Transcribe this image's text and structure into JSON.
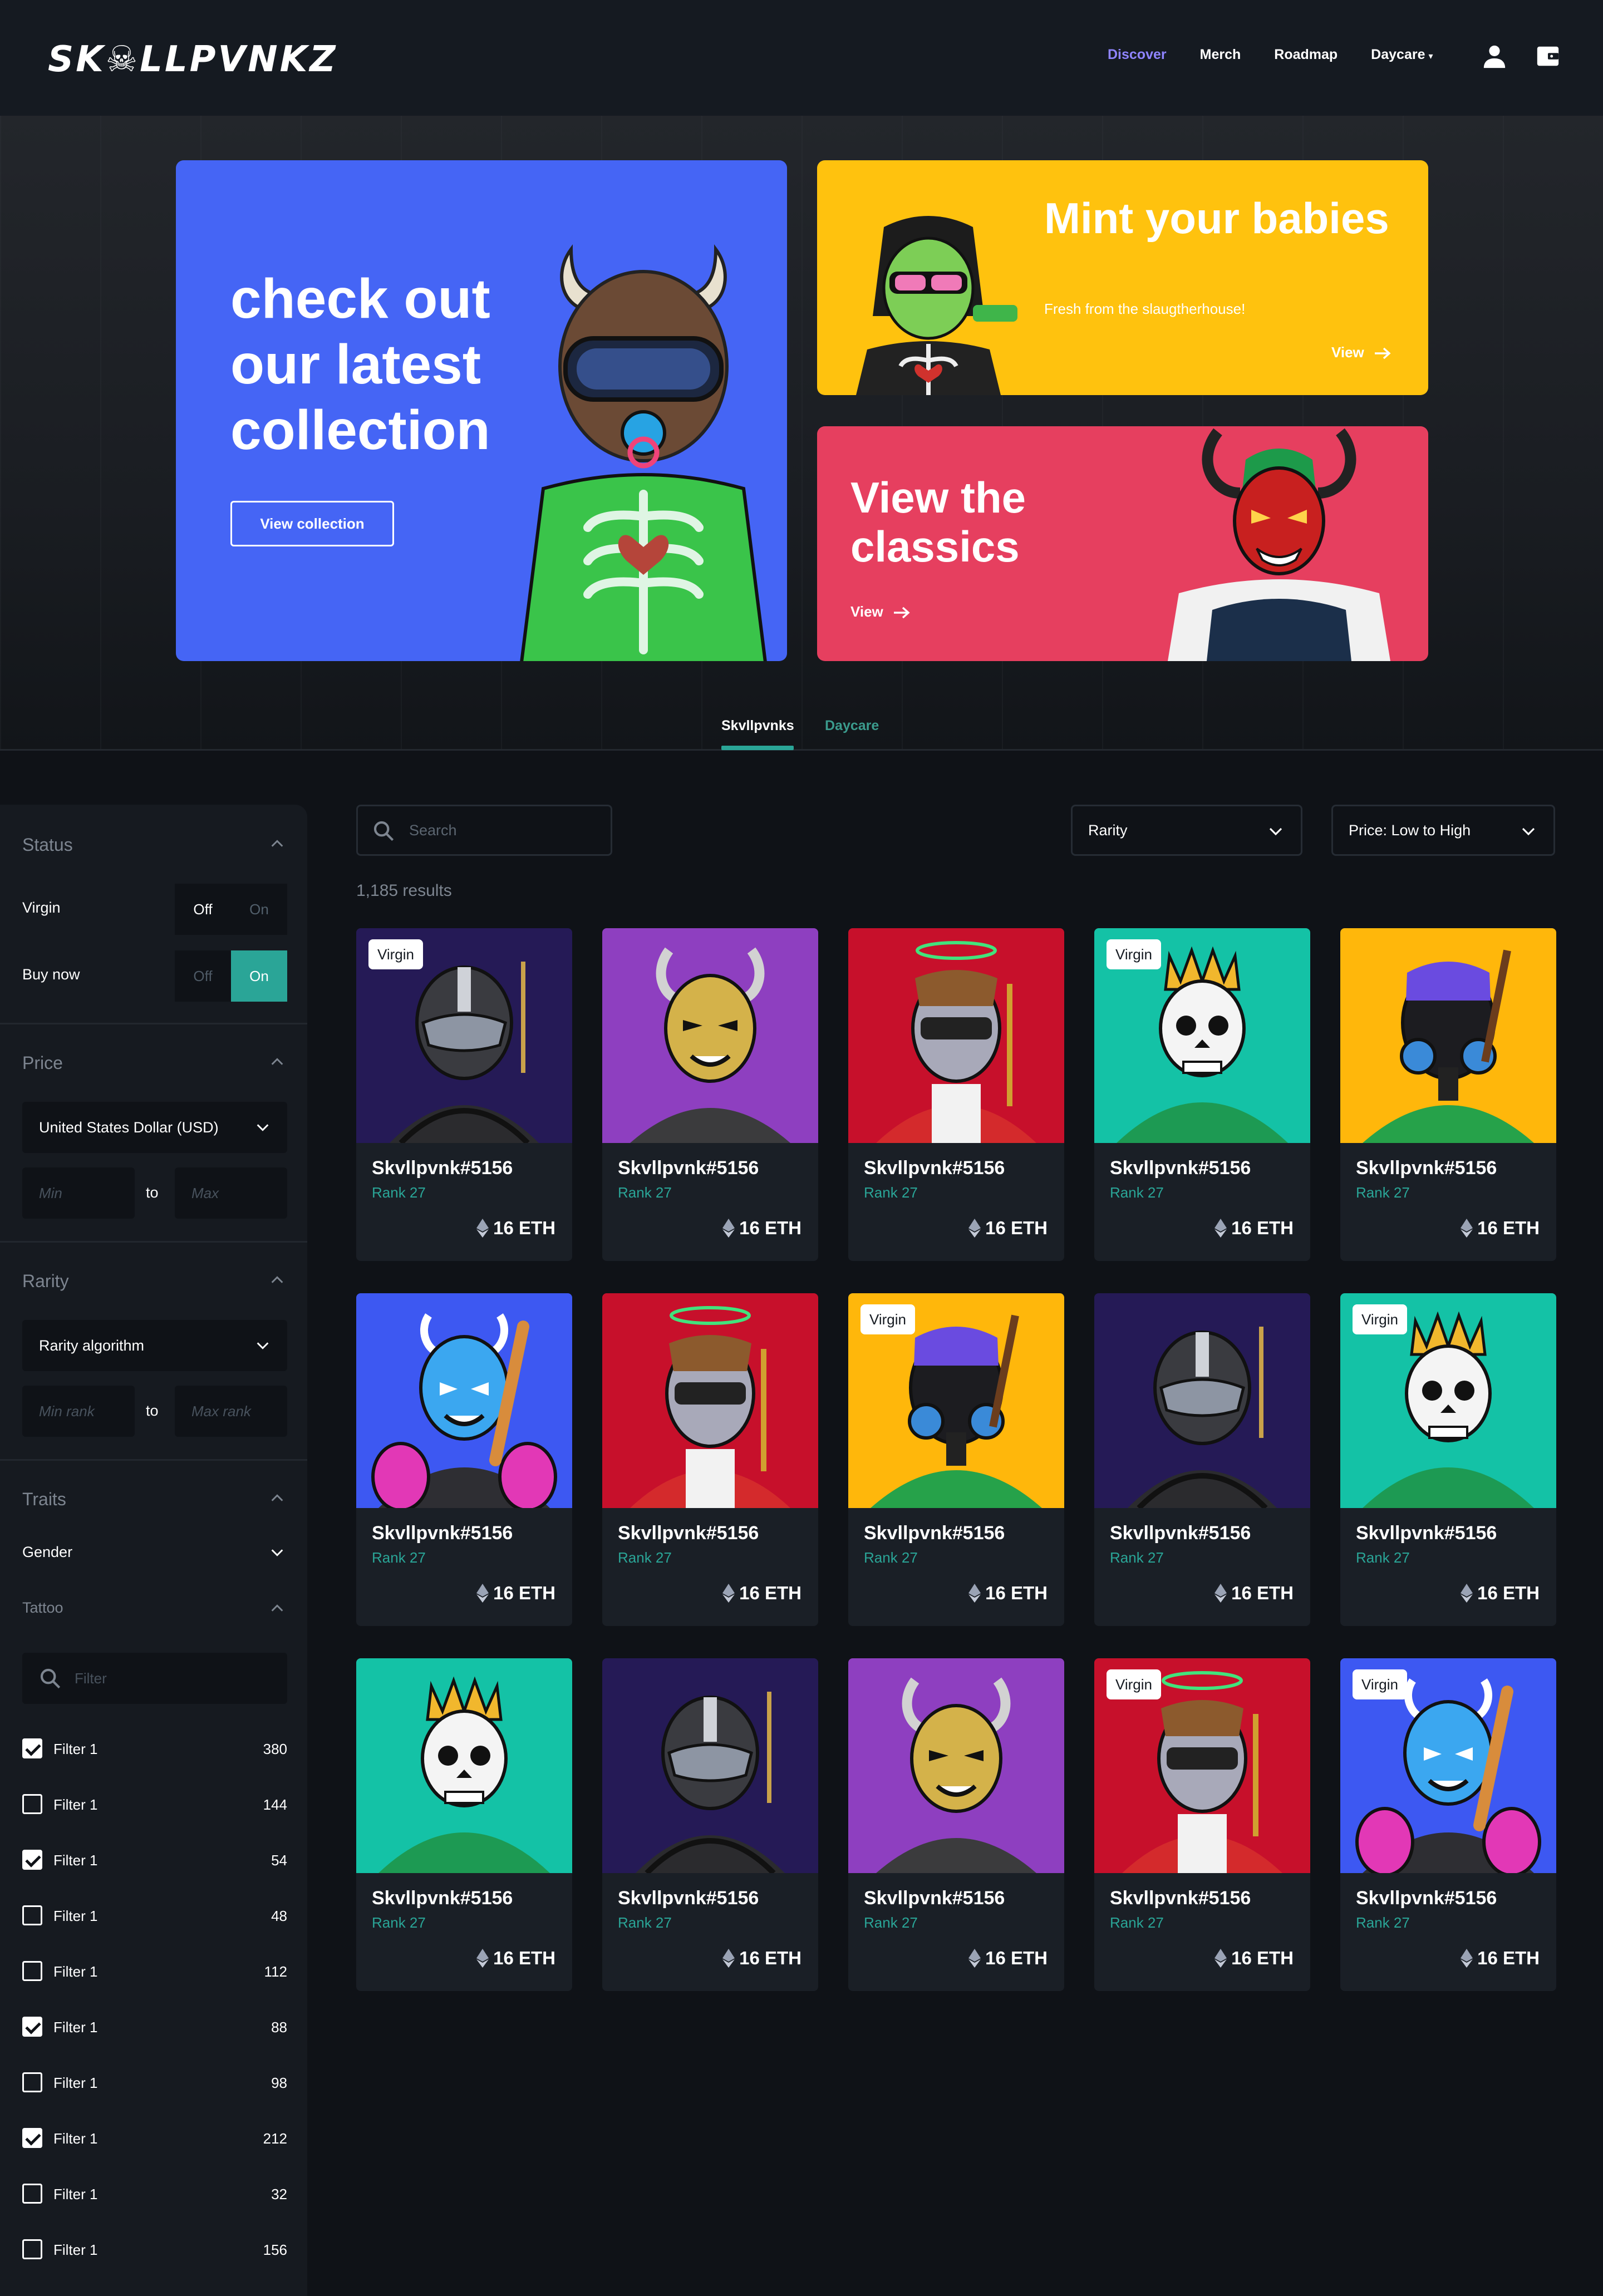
{
  "header": {
    "logo": "SK☠LLPVNKZ",
    "nav": [
      {
        "label": "Discover",
        "active": true
      },
      {
        "label": "Merch",
        "active": false
      },
      {
        "label": "Roadmap",
        "active": false
      },
      {
        "label": "Daycare",
        "active": false,
        "has_caret": true
      }
    ],
    "icons": [
      "user-icon",
      "wallet-icon"
    ]
  },
  "hero": {
    "main": {
      "title": "check out our latest collection",
      "button": "View collection",
      "color": "#4565f5"
    },
    "mint": {
      "title": "Mint your babies",
      "subtitle": "Fresh from the slaugtherhouse!",
      "link": "View",
      "color": "#ffc20e"
    },
    "classics": {
      "title": "View the classics",
      "link": "View",
      "color": "#e63f5f"
    }
  },
  "tabs": [
    {
      "label": "Skvllpvnks",
      "active": true
    },
    {
      "label": "Daycare",
      "active": false
    }
  ],
  "sidebar": {
    "status": {
      "title": "Status",
      "rows": [
        {
          "label": "Virgin",
          "off": "Off",
          "on": "On",
          "value": "off"
        },
        {
          "label": "Buy now",
          "off": "Off",
          "on": "On",
          "value": "on"
        }
      ]
    },
    "price": {
      "title": "Price",
      "currency": "United States Dollar (USD)",
      "min_placeholder": "Min",
      "to": "to",
      "max_placeholder": "Max"
    },
    "rarity": {
      "title": "Rarity",
      "algorithm": "Rarity algorithm",
      "min_placeholder": "Min rank",
      "to": "to",
      "max_placeholder": "Max rank"
    },
    "traits": {
      "title": "Traits",
      "gender": "Gender",
      "tattoo": "Tattoo",
      "filter_placeholder": "Filter",
      "filters": [
        {
          "label": "Filter 1",
          "count": "380",
          "checked": true
        },
        {
          "label": "Filter 1",
          "count": "144",
          "checked": false
        },
        {
          "label": "Filter 1",
          "count": "54",
          "checked": true
        },
        {
          "label": "Filter 1",
          "count": "48",
          "checked": false
        },
        {
          "label": "Filter 1",
          "count": "112",
          "checked": false
        },
        {
          "label": "Filter 1",
          "count": "88",
          "checked": true
        },
        {
          "label": "Filter 1",
          "count": "98",
          "checked": false
        },
        {
          "label": "Filter 1",
          "count": "212",
          "checked": true
        },
        {
          "label": "Filter 1",
          "count": "32",
          "checked": false
        },
        {
          "label": "Filter 1",
          "count": "156",
          "checked": false
        }
      ]
    }
  },
  "main": {
    "search_placeholder": "Search",
    "rarity_select": "Rarity",
    "sort_select": "Price: Low to High",
    "results": "1,185 results",
    "badge_label": "Virgin",
    "cards": [
      {
        "name": "Skvllpvnk#5156",
        "rank": "Rank 27",
        "price": "16 ETH",
        "bg": "#251a56",
        "char": "helmet",
        "virgin": true
      },
      {
        "name": "Skvllpvnk#5156",
        "rank": "Rank 27",
        "price": "16 ETH",
        "bg": "#8e3fc0",
        "char": "oni-gold",
        "virgin": false
      },
      {
        "name": "Skvllpvnk#5156",
        "rank": "Rank 27",
        "price": "16 ETH",
        "bg": "#c7102b",
        "char": "halo",
        "virgin": false
      },
      {
        "name": "Skvllpvnk#5156",
        "rank": "Rank 27",
        "price": "16 ETH",
        "bg": "#14c2a6",
        "char": "skull-king",
        "virgin": true
      },
      {
        "name": "Skvllpvnk#5156",
        "rank": "Rank 27",
        "price": "16 ETH",
        "bg": "#ffb70b",
        "char": "gasmask",
        "virgin": false
      },
      {
        "name": "Skvllpvnk#5156",
        "rank": "Rank 27",
        "price": "16 ETH",
        "bg": "#3d58f2",
        "char": "oni-blue",
        "virgin": false
      },
      {
        "name": "Skvllpvnk#5156",
        "rank": "Rank 27",
        "price": "16 ETH",
        "bg": "#c7102b",
        "char": "halo",
        "virgin": false
      },
      {
        "name": "Skvllpvnk#5156",
        "rank": "Rank 27",
        "price": "16 ETH",
        "bg": "#ffb70b",
        "char": "gasmask",
        "virgin": true
      },
      {
        "name": "Skvllpvnk#5156",
        "rank": "Rank 27",
        "price": "16 ETH",
        "bg": "#251a56",
        "char": "helmet",
        "virgin": false
      },
      {
        "name": "Skvllpvnk#5156",
        "rank": "Rank 27",
        "price": "16 ETH",
        "bg": "#14c2a6",
        "char": "skull-king",
        "virgin": true
      },
      {
        "name": "Skvllpvnk#5156",
        "rank": "Rank 27",
        "price": "16 ETH",
        "bg": "#14c2a6",
        "char": "skull-king",
        "virgin": false
      },
      {
        "name": "Skvllpvnk#5156",
        "rank": "Rank 27",
        "price": "16 ETH",
        "bg": "#251a56",
        "char": "helmet",
        "virgin": false
      },
      {
        "name": "Skvllpvnk#5156",
        "rank": "Rank 27",
        "price": "16 ETH",
        "bg": "#8e3fc0",
        "char": "oni-gold",
        "virgin": false
      },
      {
        "name": "Skvllpvnk#5156",
        "rank": "Rank 27",
        "price": "16 ETH",
        "bg": "#c7102b",
        "char": "halo",
        "virgin": true
      },
      {
        "name": "Skvllpvnk#5156",
        "rank": "Rank 27",
        "price": "16 ETH",
        "bg": "#3d58f2",
        "char": "oni-blue",
        "virgin": true
      }
    ]
  },
  "colors": {
    "accent": "#2aa597",
    "nav_active": "#8f84ff",
    "page_bg": "#0f1217",
    "panel_bg": "#161a20"
  }
}
